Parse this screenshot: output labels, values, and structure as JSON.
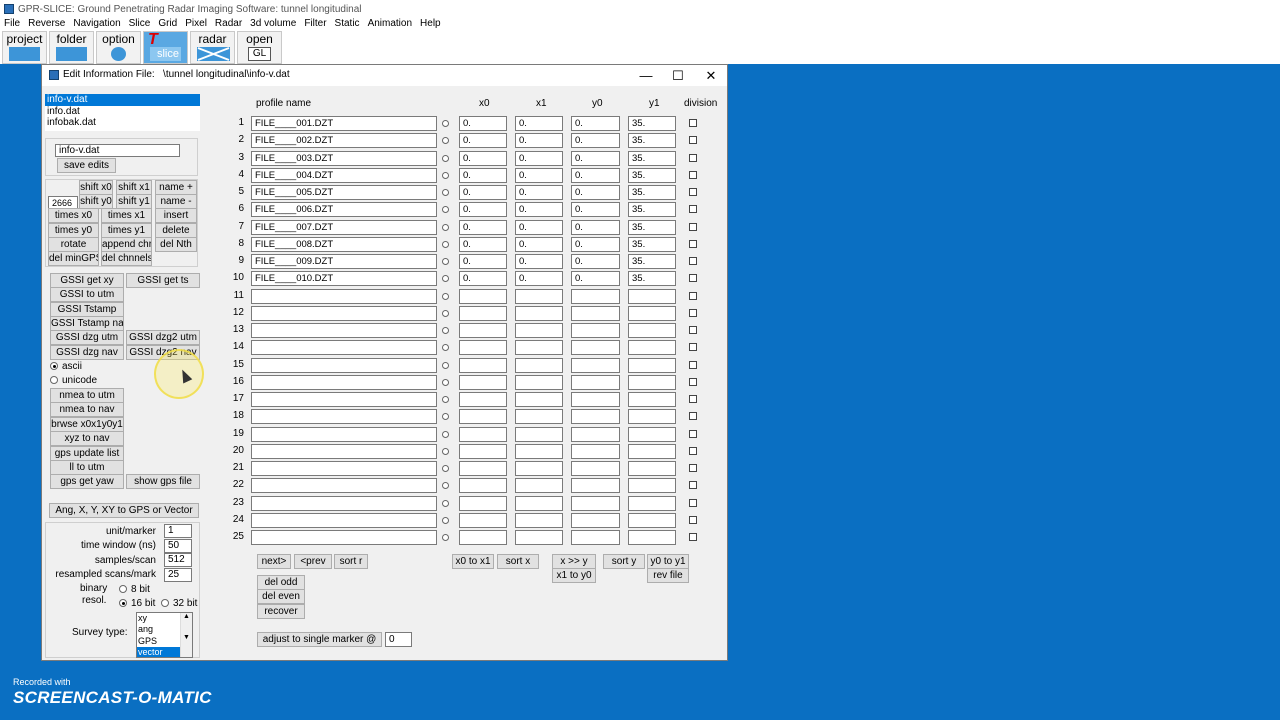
{
  "app": {
    "title": "GPR-SLICE:   Ground Penetrating Radar Imaging Software:   tunnel longitudinal",
    "menu": [
      "File",
      "Reverse",
      "Navigation",
      "Slice",
      "Grid",
      "Pixel",
      "Radar",
      "3d volume",
      "Filter",
      "Static",
      "Animation",
      "Help"
    ],
    "toolbar": [
      {
        "label": "project",
        "icon": "grid-icon"
      },
      {
        "label": "folder",
        "icon": "folder-icon"
      },
      {
        "label": "option",
        "icon": "gear-icon"
      },
      {
        "label": "T",
        "sub": "slice",
        "icon": "slice-icon"
      },
      {
        "label": "radar",
        "icon": "radar-icon"
      },
      {
        "label": "open",
        "sub": "GL",
        "icon": "opengl-icon"
      }
    ]
  },
  "dialog": {
    "title": "Edit Information File:   \\tunnel longitudinal\\info-v.dat",
    "buttons": {
      "minimize": "—",
      "maximize": "☐",
      "close": "✕"
    }
  },
  "files": [
    "info-v.dat",
    "info.dat",
    "infobak.dat"
  ],
  "selected_file_index": 0,
  "filename_input": "info-v.dat",
  "save_edits": "save edits",
  "edit_value": "2666",
  "buttons": {
    "shift_x0": "shift x0",
    "shift_x1": "shift x1",
    "name_plus": "name +",
    "shift_y0": "shift y0",
    "shift_y1": "shift y1",
    "name_minus": "name -",
    "times_x0": "times x0",
    "times_x1": "times x1",
    "insert": "insert",
    "times_y0": "times y0",
    "times_y1": "times y1",
    "delete": "delete",
    "rotate": "rotate",
    "append_chr": "append chr",
    "del_nth": "del Nth",
    "del_mingps": "del minGPS",
    "del_chnnels": "del chnnels",
    "gssi_get_xy": "GSSI get xy",
    "gssi_get_ts": "GSSI get ts",
    "gssi_to_utm": "GSSI to utm",
    "gssi_tstamp": "GSSI Tstamp",
    "gssi_tstamp_nav": "GSSI Tstamp nav",
    "gssi_dzg_utm": "GSSI dzg utm",
    "gssi_dzg2_utm": "GSSI dzg2 utm",
    "gssi_dzg_nav": "GSSI dzg nav",
    "gssi_dzg2_nav": "GSSI dzg2 nav",
    "nmea_to_utm": "nmea to utm",
    "nmea_to_nav": "nmea to nav",
    "brwse": "brwse x0x1y0y1",
    "xyz_to_nav": "xyz to nav",
    "gps_update_list": "gps update list",
    "ll_to_utm": "ll to utm",
    "gps_get_yaw": "gps get yaw",
    "show_gps_file": "show gps file",
    "ang_to_gps": "Ang, X, Y, XY to GPS or Vector",
    "next": "next>",
    "prev": "<prev",
    "sort_r": "sort r",
    "x0_to_x1": "x0 to x1",
    "sort_x": "sort x",
    "x_swap_y": "x >> y",
    "x1_to_y0": "x1 to y0",
    "sort_y": "sort y",
    "y0_to_y1": "y0 to y1",
    "rev_file": "rev file",
    "del_odd": "del odd",
    "del_even": "del even",
    "recover": "recover",
    "adjust_marker": "adjust to single marker @"
  },
  "encoding": {
    "ascii": "ascii",
    "unicode": "unicode",
    "selected": "ascii"
  },
  "params": {
    "unit_marker_label": "unit/marker",
    "unit_marker": "1",
    "time_window_label": "time window (ns)",
    "time_window": "50",
    "samples_label": "samples/scan",
    "samples": "512",
    "resampled_label": "resampled scans/mark",
    "resampled": "25",
    "binary_label": "binary",
    "resol_label": "resol.",
    "bit8": "8 bit",
    "bit16": "16 bit",
    "bit32": "32 bit",
    "bit_selected": "16 bit",
    "survey_label": "Survey type:",
    "survey_types": [
      "xy",
      "ang",
      "GPS",
      "vector"
    ],
    "survey_selected": "vector"
  },
  "adjust_value": "0",
  "table": {
    "headers": {
      "name": "profile name",
      "x0": "x0",
      "x1": "x1",
      "y0": "y0",
      "y1": "y1",
      "division": "division"
    },
    "rows": [
      {
        "n": "1",
        "name": "FILE____001.DZT",
        "x0": "0.",
        "x1": "0.",
        "y0": "0.",
        "y1": "35."
      },
      {
        "n": "2",
        "name": "FILE____002.DZT",
        "x0": "0.",
        "x1": "0.",
        "y0": "0.",
        "y1": "35."
      },
      {
        "n": "3",
        "name": "FILE____003.DZT",
        "x0": "0.",
        "x1": "0.",
        "y0": "0.",
        "y1": "35."
      },
      {
        "n": "4",
        "name": "FILE____004.DZT",
        "x0": "0.",
        "x1": "0.",
        "y0": "0.",
        "y1": "35."
      },
      {
        "n": "5",
        "name": "FILE____005.DZT",
        "x0": "0.",
        "x1": "0.",
        "y0": "0.",
        "y1": "35."
      },
      {
        "n": "6",
        "name": "FILE____006.DZT",
        "x0": "0.",
        "x1": "0.",
        "y0": "0.",
        "y1": "35."
      },
      {
        "n": "7",
        "name": "FILE____007.DZT",
        "x0": "0.",
        "x1": "0.",
        "y0": "0.",
        "y1": "35."
      },
      {
        "n": "8",
        "name": "FILE____008.DZT",
        "x0": "0.",
        "x1": "0.",
        "y0": "0.",
        "y1": "35."
      },
      {
        "n": "9",
        "name": "FILE____009.DZT",
        "x0": "0.",
        "x1": "0.",
        "y0": "0.",
        "y1": "35."
      },
      {
        "n": "10",
        "name": "FILE____010.DZT",
        "x0": "0.",
        "x1": "0.",
        "y0": "0.",
        "y1": "35."
      },
      {
        "n": "11",
        "name": "",
        "x0": "",
        "x1": "",
        "y0": "",
        "y1": ""
      },
      {
        "n": "12",
        "name": "",
        "x0": "",
        "x1": "",
        "y0": "",
        "y1": ""
      },
      {
        "n": "13",
        "name": "",
        "x0": "",
        "x1": "",
        "y0": "",
        "y1": ""
      },
      {
        "n": "14",
        "name": "",
        "x0": "",
        "x1": "",
        "y0": "",
        "y1": ""
      },
      {
        "n": "15",
        "name": "",
        "x0": "",
        "x1": "",
        "y0": "",
        "y1": ""
      },
      {
        "n": "16",
        "name": "",
        "x0": "",
        "x1": "",
        "y0": "",
        "y1": ""
      },
      {
        "n": "17",
        "name": "",
        "x0": "",
        "x1": "",
        "y0": "",
        "y1": ""
      },
      {
        "n": "18",
        "name": "",
        "x0": "",
        "x1": "",
        "y0": "",
        "y1": ""
      },
      {
        "n": "19",
        "name": "",
        "x0": "",
        "x1": "",
        "y0": "",
        "y1": ""
      },
      {
        "n": "20",
        "name": "",
        "x0": "",
        "x1": "",
        "y0": "",
        "y1": ""
      },
      {
        "n": "21",
        "name": "",
        "x0": "",
        "x1": "",
        "y0": "",
        "y1": ""
      },
      {
        "n": "22",
        "name": "",
        "x0": "",
        "x1": "",
        "y0": "",
        "y1": ""
      },
      {
        "n": "23",
        "name": "",
        "x0": "",
        "x1": "",
        "y0": "",
        "y1": ""
      },
      {
        "n": "24",
        "name": "",
        "x0": "",
        "x1": "",
        "y0": "",
        "y1": ""
      },
      {
        "n": "25",
        "name": "",
        "x0": "",
        "x1": "",
        "y0": "",
        "y1": ""
      }
    ]
  },
  "watermark": {
    "line1": "Recorded with",
    "line2": "SCREENCAST-O-MATIC"
  }
}
